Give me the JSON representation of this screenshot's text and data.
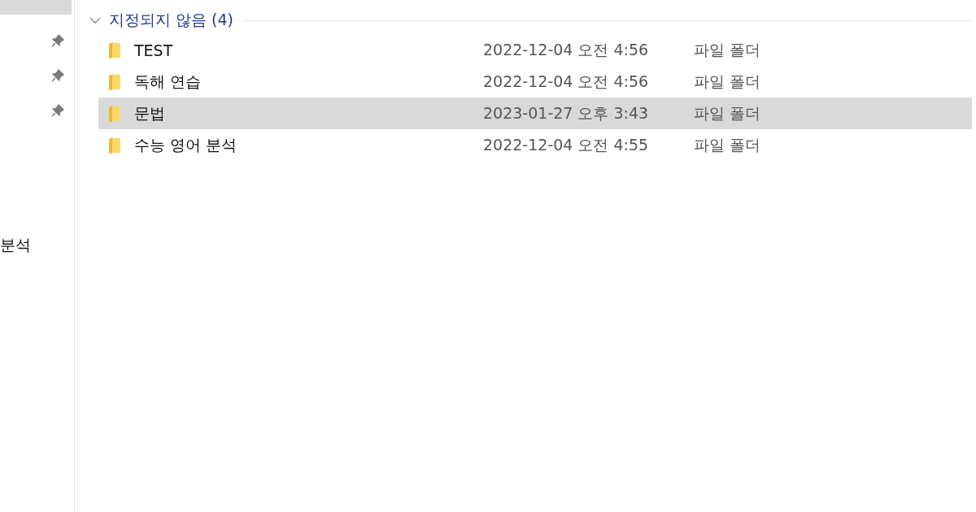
{
  "sidebar": {
    "items": [
      {
        "selected": true,
        "pinned": false
      },
      {
        "selected": false,
        "pinned": true
      },
      {
        "selected": false,
        "pinned": true
      },
      {
        "selected": false,
        "pinned": true
      },
      {
        "label": "분석",
        "selected": false,
        "pinned": false
      }
    ]
  },
  "group": {
    "title": "지정되지 않음 (4)",
    "expanded": true
  },
  "files": [
    {
      "name": "TEST",
      "date": "2022-12-04 오전 4:56",
      "type": "파일 폴더",
      "selected": false
    },
    {
      "name": "독해 연습",
      "date": "2022-12-04 오전 4:56",
      "type": "파일 폴더",
      "selected": false
    },
    {
      "name": "문법",
      "date": "2023-01-27 오후 3:43",
      "type": "파일 폴더",
      "selected": true
    },
    {
      "name": "수능 영어 분석",
      "date": "2022-12-04 오전 4:55",
      "type": "파일 폴더",
      "selected": false
    }
  ]
}
